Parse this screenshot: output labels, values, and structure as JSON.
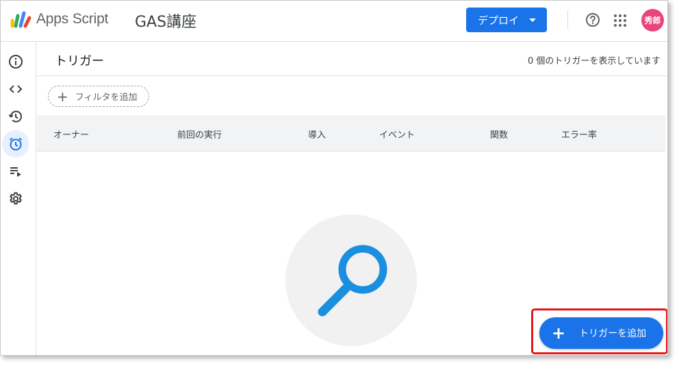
{
  "header": {
    "app_name": "Apps Script",
    "project_name": "GAS講座",
    "deploy_label": "デプロイ",
    "avatar_text": "秀郎"
  },
  "rail": {
    "items": [
      {
        "name": "overview",
        "icon": "info-icon"
      },
      {
        "name": "editor",
        "icon": "code-icon"
      },
      {
        "name": "executions",
        "icon": "history-icon"
      },
      {
        "name": "triggers",
        "icon": "alarm-icon",
        "active": true
      },
      {
        "name": "executions-list",
        "icon": "playlist-icon"
      },
      {
        "name": "settings",
        "icon": "gear-icon"
      }
    ]
  },
  "main": {
    "title": "トリガー",
    "count_text": "0 個のトリガーを表示しています",
    "filter_label": "フィルタを追加",
    "columns": [
      "オーナー",
      "前回の実行",
      "導入",
      "イベント",
      "関数",
      "エラー率"
    ],
    "add_trigger_label": "トリガーを追加"
  },
  "colors": {
    "accent": "#1a73e8",
    "avatar": "#e8457e",
    "highlight": "#e8151b",
    "search_icon": "#1a8fe0"
  }
}
